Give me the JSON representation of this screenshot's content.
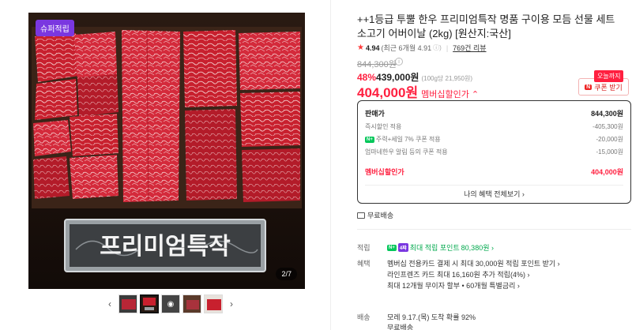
{
  "gallery": {
    "badge": "슈퍼적립",
    "banner_text": "프리미엄특작",
    "counter": "2/7",
    "prev": "‹",
    "next": "›"
  },
  "product": {
    "title": "++1등급 투뿔 한우 프리미엄특작 명품 구이용 모듬 선물 세트 소고기 어버이날 (2kg) [원산지:국산]",
    "rating": "4.94",
    "rating_recent": "(최근 6개월 4.91",
    "review_count": "769건 리뷰"
  },
  "price": {
    "original": "844,300원",
    "discount_pct": "48%",
    "discount_price": "439,000원",
    "unit_price": "(100g당 21,950원)",
    "member_price": "404,000원",
    "member_label": "멤버십할인가 ⌃"
  },
  "coupon": {
    "tag": "오늘까지",
    "n_mark": "N",
    "label": "쿠폰 받기"
  },
  "breakdown": {
    "rows": [
      {
        "label": "판매가",
        "value": "844,300원"
      },
      {
        "label": "즉시할인 적용",
        "value": "-405,300원"
      },
      {
        "label": "주력+세일 7% 쿠폰 적용",
        "value": "-20,000원"
      },
      {
        "label": "엄마네한우 알림 등의 쿠폰 적용",
        "value": "-15,000원"
      },
      {
        "label": "멤버십할인가",
        "value": "404,000원"
      }
    ],
    "np_tag": "N+",
    "benefit_link": "나의 혜택 전체보기 ›"
  },
  "shipping": {
    "free": "무료배송",
    "label": "배송",
    "line1": "모레 9.17.(목) 도착 확률 92%",
    "line2": "무료배송"
  },
  "points": {
    "label": "적립",
    "np_tag": "N+",
    "card_tag": "4쨔",
    "text": "최대 적립 포인트",
    "value": "80,380원 ›"
  },
  "benefits": {
    "label": "혜택",
    "lines": [
      "멤버십 전용카드 결제 시 최대 30,000원 적립 포인트 받기 ›",
      "라인프렌즈 카드 최대 16,160원 추가 적립(4%) ›",
      "최대 12개월 무이자 할부 • 60개월 특별금리 ›"
    ]
  }
}
